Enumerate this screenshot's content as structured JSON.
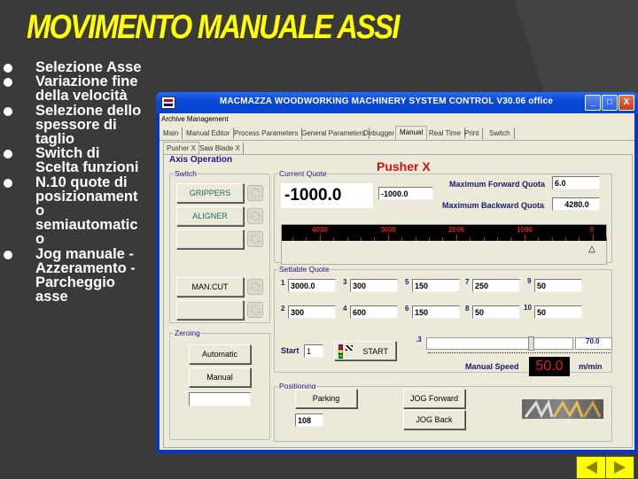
{
  "slide": {
    "title": "MOVIMENTO MANUALE ASSI",
    "bullets": [
      {
        "text": "Selezione Asse"
      },
      {
        "text": "Variazione fine\ndella velocità"
      },
      {
        "text": "Selezione dello\nspessore di\ntaglio"
      },
      {
        "text": "Switch di\nScelta funzioni"
      },
      {
        "text": "N.10 quote di\nposizionament\no\nsemiautomatic\no"
      },
      {
        "text": "Jog manuale -\nAzzeramento -\nParcheggio\nasse"
      }
    ],
    "nav": {
      "prev_icon": "triangle-left-icon",
      "next_icon": "triangle-right-icon"
    }
  },
  "window": {
    "title": "MACMAZZA WOODWORKING MACHINERY SYSTEM CONTROL  V30.06 office",
    "controls": {
      "minimize": "_",
      "maximize": "□",
      "close": "X"
    },
    "menu": "Archive Management",
    "tabs": [
      {
        "label": "Main"
      },
      {
        "label": "Manual Editor"
      },
      {
        "label": "Process Parameters"
      },
      {
        "label": "General Parameters"
      },
      {
        "label": "Debugger"
      },
      {
        "label": "Manual",
        "active": true
      },
      {
        "label": "Real Time"
      },
      {
        "label": "Print"
      },
      {
        "label": "Switch"
      }
    ],
    "subtabs": [
      {
        "label": "Pusher X",
        "active": true
      },
      {
        "label": "Saw Blade X"
      }
    ]
  },
  "axis": {
    "group_label": "Axis Operation",
    "axis_name": "Pusher X",
    "switch": {
      "label": "Switch",
      "buttons": [
        "GRIPPERS",
        "ALIGNER",
        "",
        "MAN.CUT",
        ""
      ]
    },
    "current_quote": {
      "label": "Current Quote",
      "value": "-1000.0",
      "small_value": "-1000.0",
      "max_forward_label": "Maximum Forward Quota",
      "max_forward_value": "6.0",
      "max_backward_label": "Maximum Backward Quota",
      "max_backward_value": "4280.0",
      "scale_labels": [
        "4000",
        "3000",
        "2000",
        "1000",
        "0"
      ],
      "marker_value": 0
    },
    "settable": {
      "label": "Settable Quote",
      "quotes": [
        {
          "n": "1",
          "value": "3000.0"
        },
        {
          "n": "2",
          "value": "300"
        },
        {
          "n": "3",
          "value": "300"
        },
        {
          "n": "4",
          "value": "600"
        },
        {
          "n": "5",
          "value": "150"
        },
        {
          "n": "6",
          "value": "150"
        },
        {
          "n": "7",
          "value": "250"
        },
        {
          "n": "8",
          "value": "50"
        },
        {
          "n": "9",
          "value": "50"
        },
        {
          "n": "10",
          "value": "50"
        }
      ],
      "start_label": "Start",
      "start_value": "1",
      "start_button": "START",
      "speed_min": ".3",
      "speed_max": "70.0",
      "speed_fraction": 0.71,
      "manual_speed_label": "Manual Speed",
      "manual_speed_value": "50.0",
      "speed_unit": "m/min"
    },
    "zeroing": {
      "label": "Zeroing",
      "automatic": "Automatic",
      "manual": "Manual",
      "field_value": ""
    },
    "positioning": {
      "label": "Positioning",
      "parking": "Parking",
      "parking_value": "108",
      "jog_forward": "JOG Forward",
      "jog_back": "JOG Back"
    }
  },
  "colors": {
    "title_yellow": "#ffff00",
    "axis_red": "#d01010",
    "xp_blue": "#0a36c4"
  }
}
